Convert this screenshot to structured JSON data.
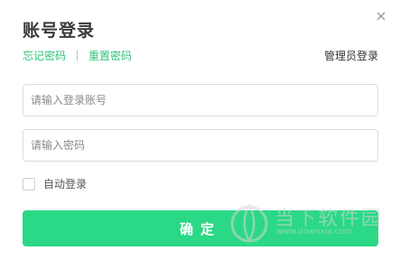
{
  "dialog": {
    "title": "账号登录",
    "links": {
      "forgot_password": "忘记密码",
      "reset_password": "重置密码",
      "admin_login": "管理员登录"
    },
    "account_input": {
      "value": "",
      "placeholder": "请输入登录账号"
    },
    "password_input": {
      "value": "",
      "placeholder": "请输入密码"
    },
    "auto_login": {
      "label": "自动登录",
      "checked": false
    },
    "confirm_label": "确定"
  },
  "watermark": {
    "text": "当下软件园",
    "url": "www.downxia.com"
  },
  "icons": {
    "close": "close-icon",
    "watermark_logo": "downxia-logo"
  },
  "colors": {
    "accent": "#2fc37a",
    "button": "#2bd886",
    "title": "#3a3a3a",
    "border": "#dcdcdc"
  }
}
